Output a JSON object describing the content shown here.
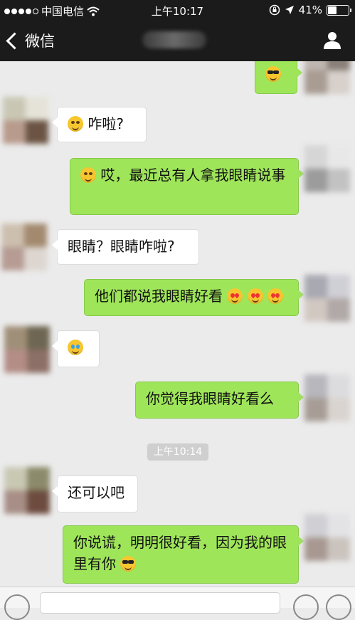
{
  "status_bar": {
    "carrier": "中国电信",
    "time": "上午10:17",
    "battery_text": "41%",
    "battery_level": 0.41
  },
  "nav": {
    "back_label": "微信"
  },
  "messages": [
    {
      "side": "out",
      "text": "",
      "emoji": [
        "cool"
      ]
    },
    {
      "side": "in",
      "text": "咋啦?",
      "emoji_before": [
        "grin"
      ]
    },
    {
      "side": "out",
      "text": "哎，最近总有人拿我眼睛说事",
      "emoji_before": [
        "flushed"
      ]
    },
    {
      "side": "in",
      "text": "眼睛？眼睛咋啦?"
    },
    {
      "side": "out",
      "text": "他们都说我眼睛好看",
      "emoji": [
        "heart-eyes",
        "heart-eyes",
        "heart-eyes"
      ]
    },
    {
      "side": "in",
      "text": "",
      "emoji": [
        "laugh-cry"
      ]
    },
    {
      "side": "out",
      "text": "你觉得我眼睛好看么"
    },
    {
      "side": "in",
      "text": "还可以吧"
    },
    {
      "side": "out",
      "text": "你说谎，明明很好看，因为我的眼里有你",
      "emoji": [
        "cool"
      ]
    }
  ],
  "timestamp": "上午10:14",
  "icons": {
    "signal": "signal-dots-icon",
    "wifi": "wifi-icon",
    "lock": "rotation-lock-icon",
    "location": "location-arrow-icon",
    "battery": "battery-icon",
    "profile": "profile-icon",
    "voice": "voice-icon",
    "emoji": "emoji-icon",
    "plus": "plus-icon"
  },
  "colors": {
    "outgoing_bubble": "#9fe55a",
    "incoming_bubble": "#ffffff",
    "background": "#ebebeb",
    "header": "#1b1b1b"
  }
}
